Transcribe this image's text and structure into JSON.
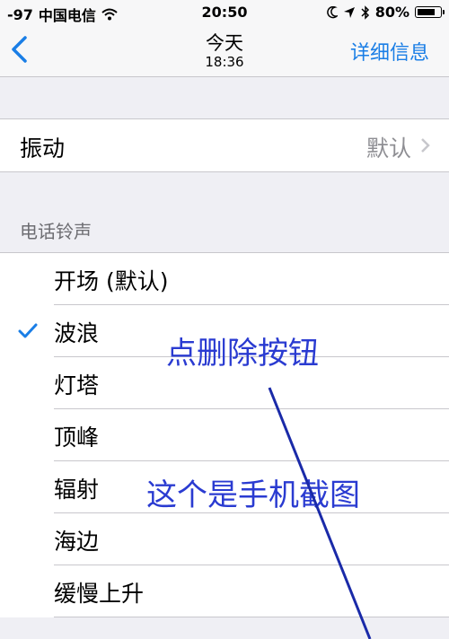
{
  "status_bar": {
    "signal": "-97",
    "carrier": "中国电信",
    "time": "20:50",
    "battery": "80%",
    "battery_level": 0.8,
    "icons": [
      "wifi-icon",
      "moon-icon",
      "location-arrow-icon",
      "bluetooth-icon",
      "battery-icon"
    ]
  },
  "nav": {
    "title": "今天",
    "subtitle": "18:36",
    "details": "详细信息",
    "back_icon": "chevron-left-icon"
  },
  "vibration": {
    "label": "振动",
    "value": "默认"
  },
  "ringtones": {
    "header": "电话铃声",
    "items": [
      {
        "name": "开场 (默认)",
        "selected": false
      },
      {
        "name": "波浪",
        "selected": true
      },
      {
        "name": "灯塔",
        "selected": false
      },
      {
        "name": "顶峰",
        "selected": false
      },
      {
        "name": "辐射",
        "selected": false
      },
      {
        "name": "海边",
        "selected": false
      },
      {
        "name": "缓慢上升",
        "selected": false
      }
    ]
  },
  "annotations": {
    "text1": "点删除按钮",
    "text2": "这个是手机截图"
  },
  "colors": {
    "accent": "#1a7ee6",
    "annotation": "#2a3bd1",
    "background": "#efeff4"
  }
}
